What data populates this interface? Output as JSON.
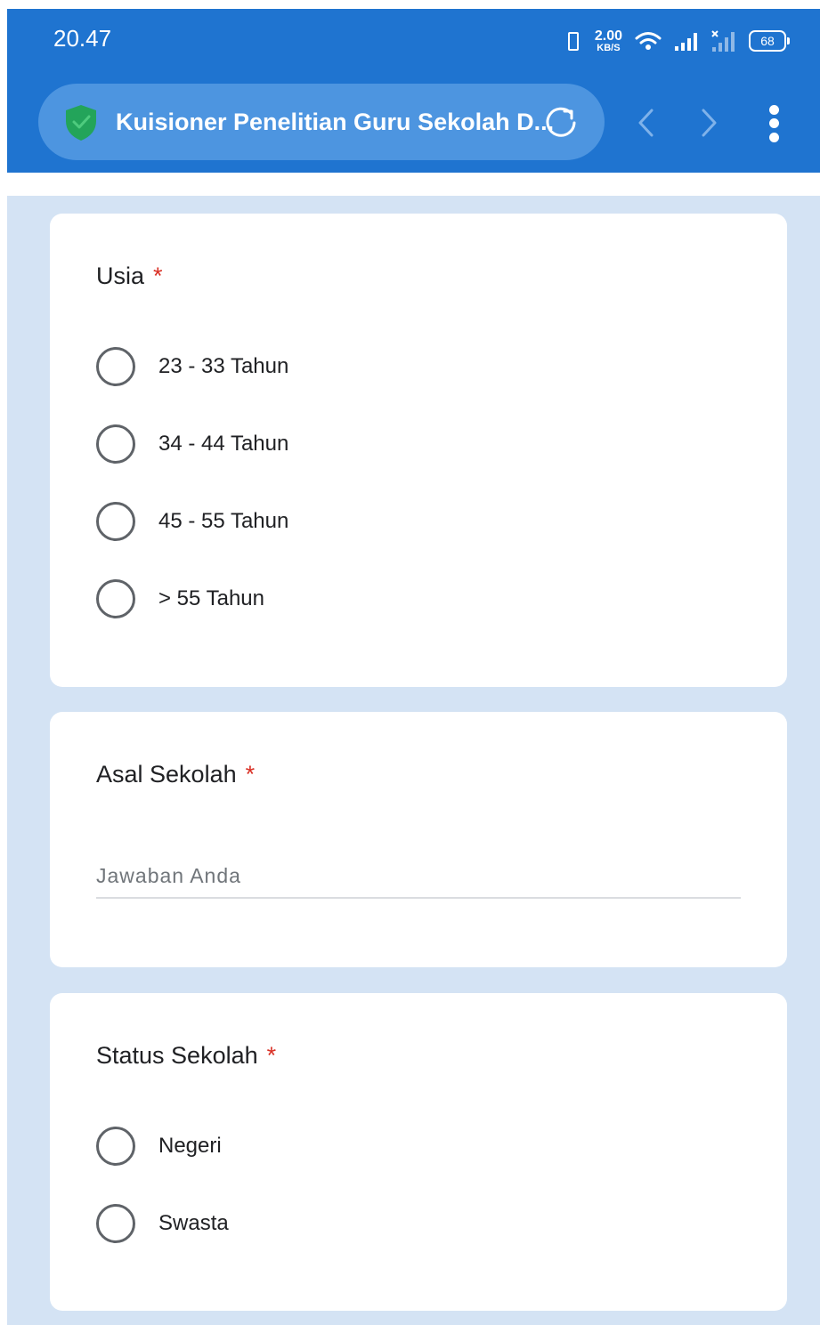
{
  "status_bar": {
    "time": "20.47",
    "network_speed_value": "2.00",
    "network_speed_unit": "KB/S",
    "battery": "68",
    "icons": [
      "vibrate-icon",
      "wifi-icon",
      "signal-icon",
      "signal-off-icon"
    ]
  },
  "browser": {
    "page_title": "Kuisioner Penelitian Guru Sekolah D...",
    "icons": [
      "shield-icon",
      "reload-icon",
      "back-icon",
      "forward-icon",
      "menu-icon"
    ],
    "colors": {
      "toolbar": "#1f74d0",
      "url_pill": "#4d95e0",
      "shield": "#23a45a"
    }
  },
  "form": {
    "background": "#d4e3f4",
    "required_color": "#d93025",
    "required_mark": "*",
    "questions": [
      {
        "title": "Usia",
        "type": "radio",
        "options": [
          "23 - 33 Tahun",
          "34 - 44 Tahun",
          "45 - 55 Tahun",
          "> 55 Tahun"
        ]
      },
      {
        "title": "Asal Sekolah",
        "type": "text",
        "placeholder": "Jawaban Anda",
        "value": ""
      },
      {
        "title": "Status Sekolah",
        "type": "radio",
        "options": [
          "Negeri",
          "Swasta"
        ]
      }
    ]
  }
}
